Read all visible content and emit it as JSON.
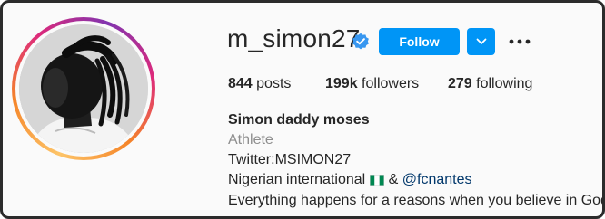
{
  "profile": {
    "username": "m_simon27",
    "follow_label": "Follow",
    "stats": {
      "posts_count": "844",
      "posts_label": "posts",
      "followers_count": "199k",
      "followers_label": "followers",
      "following_count": "279",
      "following_label": "following"
    },
    "bio": {
      "name": "Simon daddy moses",
      "category": "Athlete",
      "line1": "Twitter:MSIMON27",
      "line2_text": "Nigerian international",
      "line2_amp": "&",
      "line2_mention": "@fcnantes",
      "line3": "Everything happens for a reasons when you believe in God"
    }
  },
  "icons": {
    "verified": "verified-badge-icon",
    "dropdown": "chevron-down-icon",
    "more": "more-options-icon",
    "flag": "nigeria-flag-emoji",
    "hands": "folded-hands-emoji"
  },
  "colors": {
    "accent": "#0095f6",
    "verified": "#3897f0",
    "mention": "#00376b",
    "muted": "#8e8e8e",
    "text": "#262626"
  }
}
